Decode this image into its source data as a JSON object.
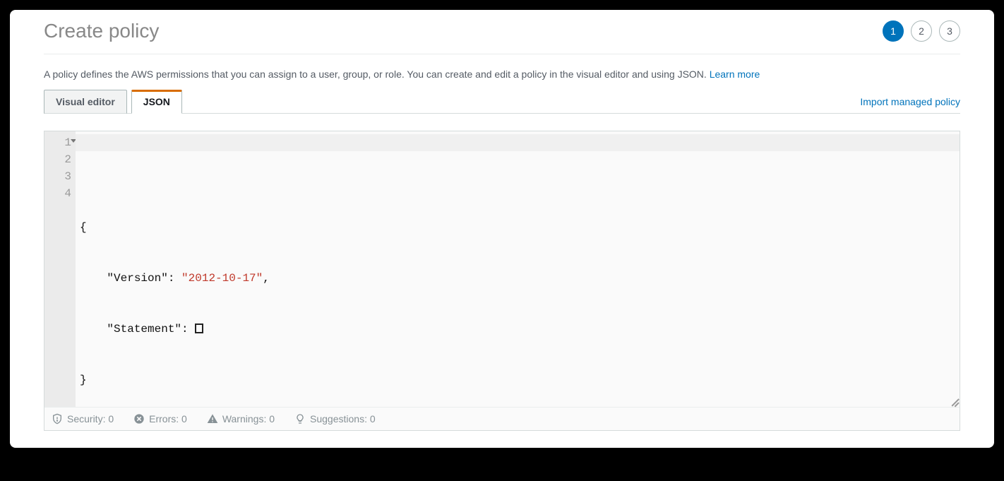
{
  "header": {
    "title": "Create policy",
    "steps": [
      "1",
      "2",
      "3"
    ],
    "active_step_index": 0
  },
  "description": {
    "text": "A policy defines the AWS permissions that you can assign to a user, group, or role. You can create and edit a policy in the visual editor and using JSON. ",
    "learn_more": "Learn more"
  },
  "tabs": {
    "visual_editor": "Visual editor",
    "json": "JSON"
  },
  "import_link": "Import managed policy",
  "editor": {
    "gutter": [
      "1",
      "2",
      "3",
      "4"
    ],
    "line1": "{",
    "line2_key": "\"Version\"",
    "line2_sep": ": ",
    "line2_val": "\"2012-10-17\"",
    "line2_end": ",",
    "line3_key": "\"Statement\"",
    "line3_sep": ": ",
    "line4": "}"
  },
  "status": {
    "security": "Security: 0",
    "errors": "Errors: 0",
    "warnings": "Warnings: 0",
    "suggestions": "Suggestions: 0"
  }
}
